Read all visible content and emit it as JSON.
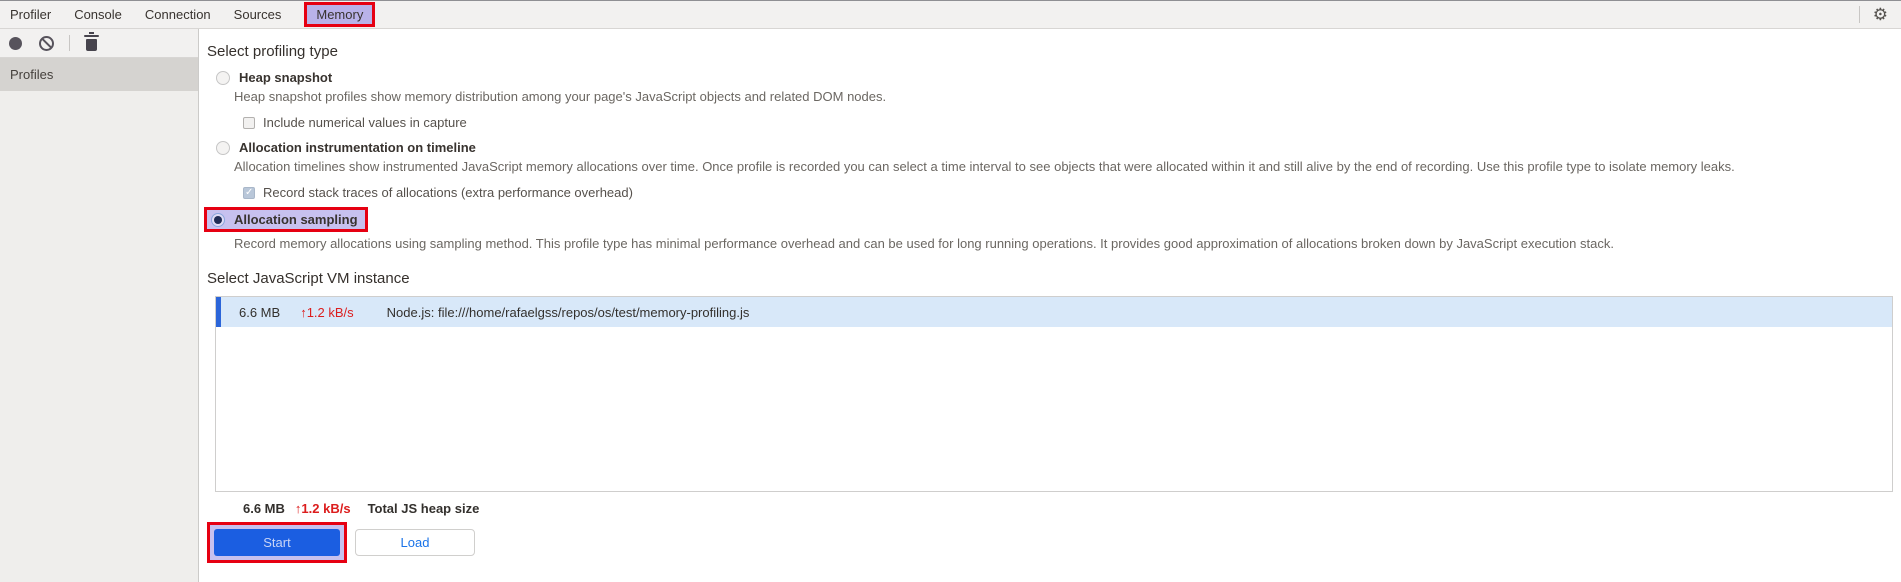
{
  "colors": {
    "annotation_red": "#e60012",
    "annotation_fill_lavender": "#c7c1ef",
    "active_tab_lavender": "#b9b2e9",
    "vm_row_blue_bg": "#d8e8f9",
    "vm_row_accent_blue": "#2b65d9",
    "rate_red_text": "#dc1d1d",
    "start_button_blue": "#1b5ee1",
    "load_button_text_blue": "#1a73e8"
  },
  "tabs": [
    {
      "label": "Profiler",
      "active": false
    },
    {
      "label": "Console",
      "active": false
    },
    {
      "label": "Connection",
      "active": false
    },
    {
      "label": "Sources",
      "active": false
    },
    {
      "label": "Memory",
      "active": true
    }
  ],
  "toolbar": {
    "icons": [
      {
        "name": "record-icon"
      },
      {
        "name": "clear-icon"
      },
      {
        "name": "trash-icon"
      }
    ],
    "settings_icon": "gear-icon",
    "gear_glyph": "⚙"
  },
  "sidebar": {
    "header": "Profiles"
  },
  "content": {
    "profiling_heading": "Select profiling type",
    "options": [
      {
        "label": "Heap snapshot",
        "selected": false,
        "description": "Heap snapshot profiles show memory distribution among your page's JavaScript objects and related DOM nodes.",
        "sub_checkbox": {
          "label": "Include numerical values in capture",
          "checked": false,
          "disabled": false
        }
      },
      {
        "label": "Allocation instrumentation on timeline",
        "selected": false,
        "description": "Allocation timelines show instrumented JavaScript memory allocations over time. Once profile is recorded you can select a time interval to see objects that were allocated within it and still alive by the end of recording. Use this profile type to isolate memory leaks.",
        "sub_checkbox": {
          "label": "Record stack traces of allocations (extra performance overhead)",
          "checked": true,
          "disabled": true
        }
      },
      {
        "label": "Allocation sampling",
        "selected": true,
        "highlighted": true,
        "description": "Record memory allocations using sampling method. This profile type has minimal performance overhead and can be used for long running operations. It provides good approximation of allocations broken down by JavaScript execution stack."
      }
    ],
    "vm_heading": "Select JavaScript VM instance",
    "vm_row": {
      "size": "6.6 MB",
      "arrow": "↑",
      "rate": "1.2 kB/s",
      "name": "Node.js: file:///home/rafaelgss/repos/os/test/memory-profiling.js"
    },
    "total": {
      "size": "6.6 MB",
      "arrow": "↑",
      "rate": "1.2 kB/s",
      "label": "Total JS heap size"
    },
    "buttons": {
      "start": "Start",
      "load": "Load"
    }
  }
}
